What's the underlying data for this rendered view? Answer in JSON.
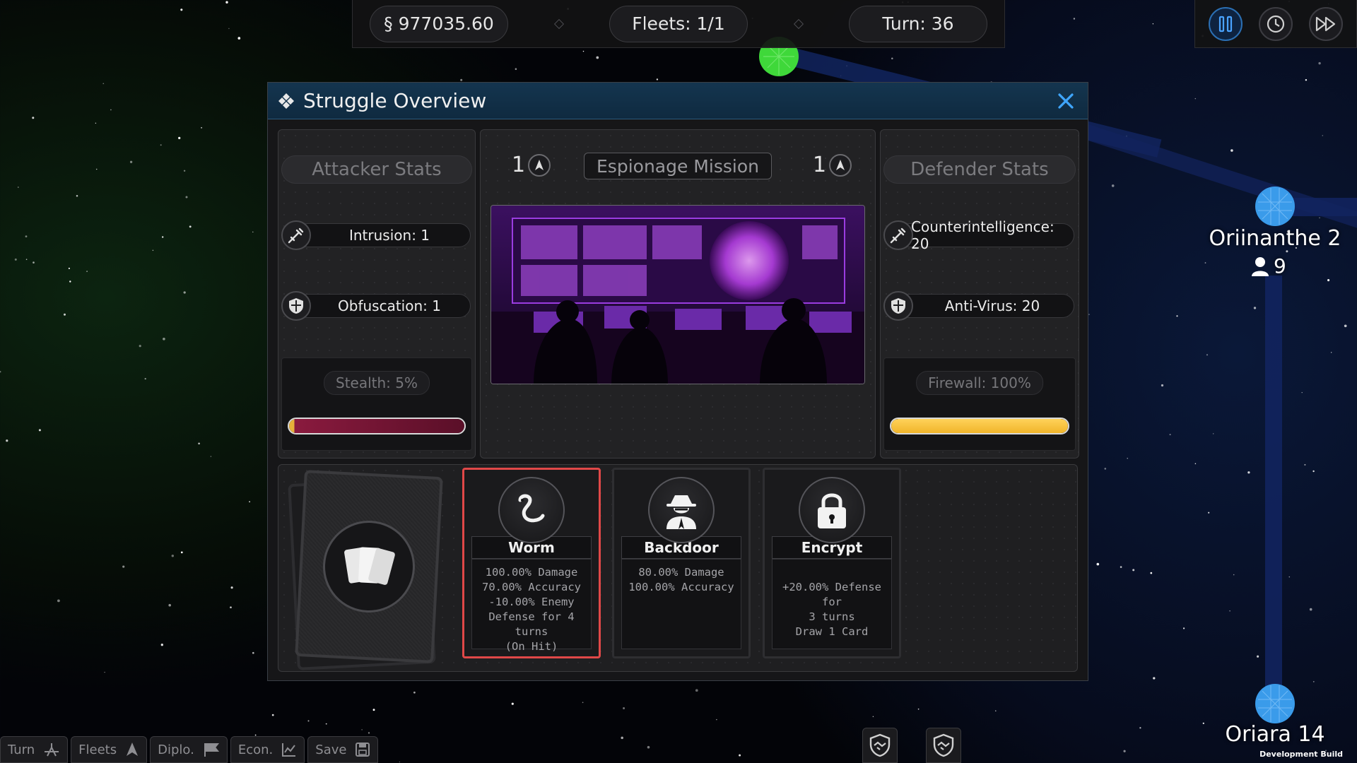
{
  "topbar": {
    "credits": "§ 977035.60",
    "fleets": "Fleets: 1/1",
    "turn": "Turn: 36"
  },
  "map": {
    "planets": [
      {
        "name": "Oriinanthe 2",
        "population": "9",
        "color": "#3a9bea"
      },
      {
        "name": "Oriara 14",
        "population": "",
        "color": "#3a9bea"
      }
    ]
  },
  "dialog": {
    "title": "Struggle Overview",
    "attacker": {
      "header": "Attacker Stats",
      "stats": [
        {
          "label": "Intrusion: 1",
          "icon": "syringe-icon"
        },
        {
          "label": "Obfuscation: 1",
          "icon": "shield-icon"
        }
      ],
      "meter_label": "Stealth: 5%",
      "meter_value": 0.05,
      "meter_color": "#8a1a3e"
    },
    "defender": {
      "header": "Defender Stats",
      "stats": [
        {
          "label": "Counterintelligence: 20",
          "icon": "syringe-icon"
        },
        {
          "label": "Anti-Virus: 20",
          "icon": "shield-icon"
        }
      ],
      "meter_label": "Firewall: 100%",
      "meter_value": 1.0,
      "meter_color": "#f0b52a"
    },
    "mission": {
      "title": "Espionage Mission",
      "attacker_fleets": "1",
      "defender_fleets": "1"
    },
    "cards": [
      {
        "name": "Worm",
        "icon": "worm-icon",
        "selected": true,
        "lines": [
          "100.00% Damage",
          "70.00% Accuracy",
          "-10.00% Enemy",
          "Defense for 4 turns",
          "(On Hit)"
        ]
      },
      {
        "name": "Backdoor",
        "icon": "spy-icon",
        "selected": false,
        "lines": [
          "80.00% Damage",
          "100.00% Accuracy"
        ]
      },
      {
        "name": "Encrypt",
        "icon": "lock-icon",
        "selected": false,
        "lines": [
          "",
          "+20.00% Defense for",
          "3 turns",
          "Draw 1 Card"
        ]
      }
    ]
  },
  "bottombar": {
    "buttons": [
      "Turn",
      "Fleets",
      "Diplo.",
      "Econ.",
      "Save"
    ]
  },
  "footer": {
    "dev_build": "Development Build"
  }
}
